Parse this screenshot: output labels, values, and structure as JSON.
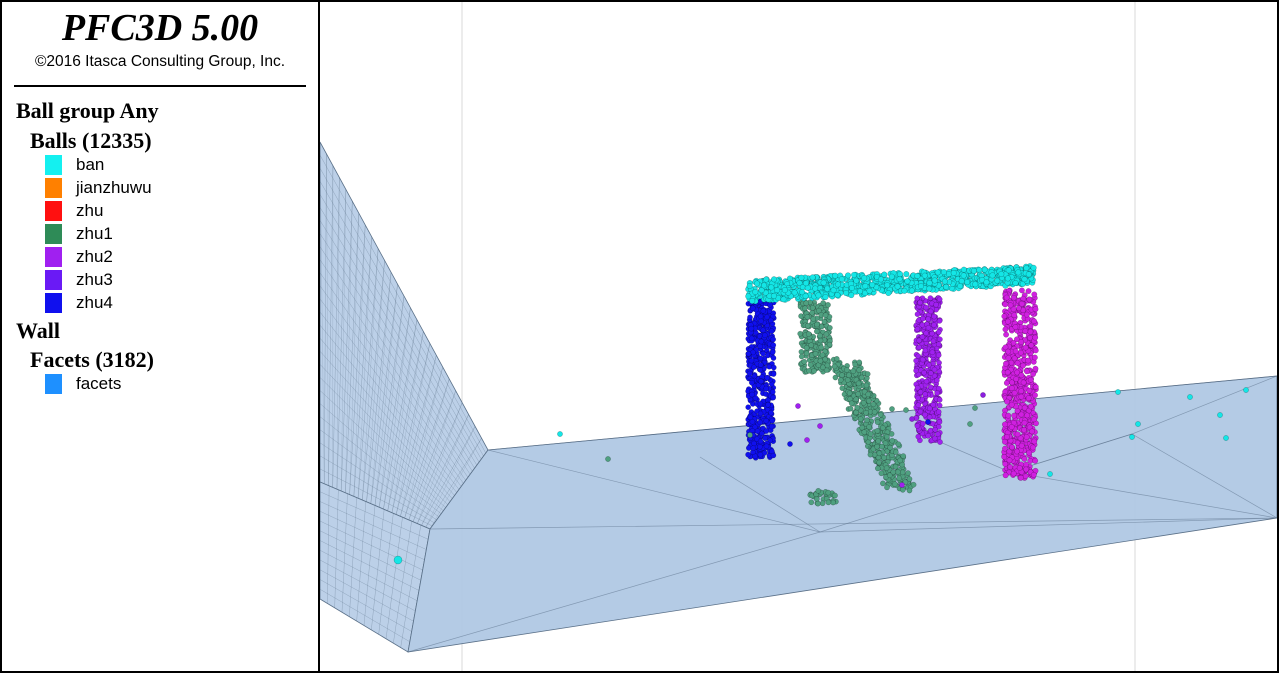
{
  "app": {
    "title": "PFC3D 5.00",
    "copyright": "©2016 Itasca Consulting Group, Inc."
  },
  "legend": {
    "ball_header": "Ball group Any",
    "balls_header": "Balls (12335)",
    "ball_groups": [
      {
        "label": "ban",
        "color": "#14f0f0"
      },
      {
        "label": "jianzhuwu",
        "color": "#ff8000"
      },
      {
        "label": "zhu",
        "color": "#ff1010"
      },
      {
        "label": "zhu1",
        "color": "#2e8b57"
      },
      {
        "label": "zhu2",
        "color": "#a020f0"
      },
      {
        "label": "zhu3",
        "color": "#6a1af5"
      },
      {
        "label": "zhu4",
        "color": "#1010ee"
      }
    ],
    "wall_header": "Wall",
    "facets_header": "Facets (3182)",
    "facet_groups": [
      {
        "label": "facets",
        "color": "#1e90ff"
      }
    ]
  },
  "scene": {
    "wall_fill": "#b0c8e4",
    "wall_edge": "#5a7088",
    "ball_colors": {
      "ban": "#14e6e6",
      "zhu1": "#4fa080",
      "zhu2": "#a020f0",
      "zhu3": "#8c1ee0",
      "zhu4": "#1010ee",
      "magenta": "#d020e0"
    }
  }
}
